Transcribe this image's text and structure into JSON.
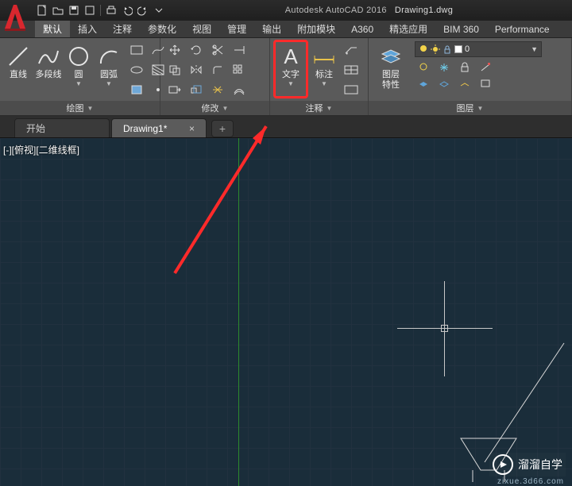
{
  "title": {
    "app": "Autodesk AutoCAD 2016",
    "file": "Drawing1.dwg"
  },
  "qat_icons": [
    "new",
    "open",
    "save",
    "undo",
    "redo",
    "plot",
    "share",
    "dd"
  ],
  "tabs": {
    "items": [
      "默认",
      "插入",
      "注释",
      "参数化",
      "视图",
      "管理",
      "输出",
      "附加模块",
      "A360",
      "精选应用",
      "BIM 360",
      "Performance"
    ],
    "active": 0
  },
  "panels": {
    "draw": {
      "title": "绘图",
      "big": [
        {
          "label": "直线",
          "icon": "line"
        },
        {
          "label": "多段线",
          "icon": "polyline"
        },
        {
          "label": "圆",
          "icon": "circle"
        },
        {
          "label": "圆弧",
          "icon": "arc"
        }
      ]
    },
    "modify": {
      "title": "修改"
    },
    "annot": {
      "title": "注释",
      "text": {
        "label": "文字",
        "icon": "text"
      },
      "dim": {
        "label": "标注",
        "icon": "dim"
      }
    },
    "layers": {
      "title": "图层",
      "props_label": "图层\n特性",
      "dropdown_value": "0"
    }
  },
  "doc_tabs": {
    "items": [
      {
        "label": "开始",
        "dirty": false
      },
      {
        "label": "Drawing1*",
        "dirty": true
      }
    ],
    "active": 1
  },
  "viewport": {
    "label": "[-][俯视][二维线框]"
  },
  "watermark": {
    "main": "溜溜自学",
    "sub": "zixue.3d66.com"
  }
}
